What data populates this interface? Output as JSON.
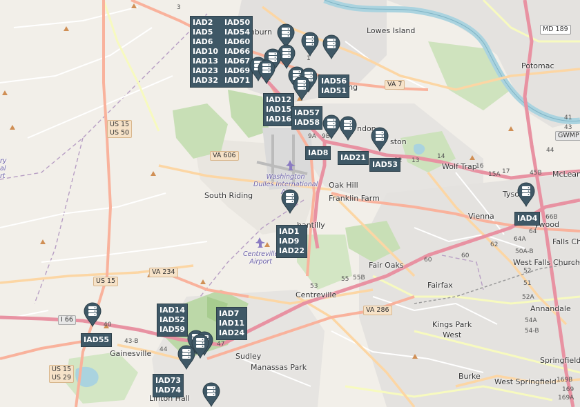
{
  "map": {
    "place_labels": [
      {
        "id": "ashburn",
        "text": "shburn"
      },
      {
        "id": "lowes-island",
        "text": "Lowes Island"
      },
      {
        "id": "potomac",
        "text": "Potomac"
      },
      {
        "id": "sterling",
        "text": "ling"
      },
      {
        "id": "herndon",
        "text": "ndon"
      },
      {
        "id": "reston",
        "text": "ston"
      },
      {
        "id": "wolf-trap",
        "text": "Wolf Trap"
      },
      {
        "id": "mclean",
        "text": "McLean"
      },
      {
        "id": "tysons",
        "text": "Tyso"
      },
      {
        "id": "tysons2",
        "text": "ywood"
      },
      {
        "id": "vienna",
        "text": "Vienna"
      },
      {
        "id": "falls-church",
        "text": "Falls Ch"
      },
      {
        "id": "west-falls-church",
        "text": "West Falls Church"
      },
      {
        "id": "oak-hill",
        "text": "Oak Hill"
      },
      {
        "id": "franklin-farm",
        "text": "Franklin Farm"
      },
      {
        "id": "south-riding",
        "text": "South Riding"
      },
      {
        "id": "chantilly",
        "text": "hantilly"
      },
      {
        "id": "fair-oaks",
        "text": "Fair Oaks"
      },
      {
        "id": "fairfax",
        "text": "Fairfax"
      },
      {
        "id": "centreville",
        "text": "Centreville"
      },
      {
        "id": "annandale",
        "text": "Annandale"
      },
      {
        "id": "kings-park-west",
        "text": "Kings Park\nWest"
      },
      {
        "id": "springfield",
        "text": "Springfield"
      },
      {
        "id": "burke",
        "text": "Burke"
      },
      {
        "id": "west-springfield",
        "text": "West Springfield"
      },
      {
        "id": "sudley",
        "text": "Sudley"
      },
      {
        "id": "manassas-park",
        "text": "Manassas Park"
      },
      {
        "id": "gainesville",
        "text": "Gainesville"
      },
      {
        "id": "linton-hall",
        "text": "Linton Hall"
      },
      {
        "id": "left-edge-1",
        "text": "ry"
      },
      {
        "id": "left-edge-2",
        "text": "al"
      },
      {
        "id": "left-edge-3",
        "text": "rt"
      }
    ],
    "airports": [
      {
        "id": "dulles",
        "text": "Washington\nDulles International\nAir"
      },
      {
        "id": "centreville-airport",
        "text": "Centreville\nAirport"
      }
    ],
    "shields": [
      {
        "id": "md189",
        "text": "MD 189"
      },
      {
        "id": "us15-us50",
        "text": "US 15\nUS 50"
      },
      {
        "id": "va606",
        "text": "VA 606"
      },
      {
        "id": "va7",
        "text": "VA 7"
      },
      {
        "id": "va234",
        "text": "VA 234"
      },
      {
        "id": "us15",
        "text": "US 15"
      },
      {
        "id": "va286",
        "text": "VA 286"
      },
      {
        "id": "i66",
        "text": "I 66"
      },
      {
        "id": "us15-us29",
        "text": "US 15\nUS 29"
      },
      {
        "id": "gwmp",
        "text": "GWMP"
      }
    ],
    "road_numbers": [
      {
        "id": "n-12",
        "text": "12"
      },
      {
        "id": "n-13",
        "text": "13"
      },
      {
        "id": "n-14",
        "text": "14"
      },
      {
        "id": "n-15a",
        "text": "15A"
      },
      {
        "id": "n-16",
        "text": "16"
      },
      {
        "id": "n-17",
        "text": "17"
      },
      {
        "id": "n-45b",
        "text": "45B"
      },
      {
        "id": "n-44",
        "text": "44"
      },
      {
        "id": "n-43",
        "text": "43"
      },
      {
        "id": "n-41",
        "text": "41"
      },
      {
        "id": "n-66b",
        "text": "66B"
      },
      {
        "id": "n-64",
        "text": "64"
      },
      {
        "id": "n-64a",
        "text": "64A"
      },
      {
        "id": "n-62",
        "text": "62"
      },
      {
        "id": "n-60a",
        "text": "60"
      },
      {
        "id": "n-60b",
        "text": "60"
      },
      {
        "id": "n-55",
        "text": "55"
      },
      {
        "id": "n-55b",
        "text": "55B"
      },
      {
        "id": "n-53",
        "text": "53"
      },
      {
        "id": "n-52",
        "text": "52"
      },
      {
        "id": "n-52a",
        "text": "52A"
      },
      {
        "id": "n-54a",
        "text": "54A"
      },
      {
        "id": "n-54b",
        "text": "54-B"
      },
      {
        "id": "n-51",
        "text": "51"
      },
      {
        "id": "n-50a",
        "text": "50A-B"
      },
      {
        "id": "n-169b",
        "text": "169B"
      },
      {
        "id": "n-169",
        "text": "169"
      },
      {
        "id": "n-169a",
        "text": "169A"
      },
      {
        "id": "n-47",
        "text": "47"
      },
      {
        "id": "n-44b",
        "text": "44"
      },
      {
        "id": "n-43b",
        "text": "43-B"
      },
      {
        "id": "n-40",
        "text": "40"
      },
      {
        "id": "n-9a",
        "text": "9A"
      },
      {
        "id": "n-9b",
        "text": "9B"
      },
      {
        "id": "n-3",
        "text": "3"
      },
      {
        "id": "n-1",
        "text": "1"
      }
    ],
    "datacenter_labels": [
      {
        "id": "grp-ashburn",
        "cols": true,
        "items": [
          "IAD2",
          "IAD50",
          "IAD5",
          "IAD54",
          "IAD6",
          "IAD60",
          "IAD10",
          "IAD66",
          "IAD13",
          "IAD67",
          "IAD23",
          "IAD69",
          "IAD32",
          "IAD71"
        ]
      },
      {
        "id": "grp-iad56",
        "items": [
          "IAD56",
          "IAD51"
        ]
      },
      {
        "id": "grp-iad12",
        "items": [
          "IAD12",
          "IAD15",
          "IAD16"
        ]
      },
      {
        "id": "grp-iad57",
        "items": [
          "IAD57",
          "IAD58"
        ]
      },
      {
        "id": "grp-iad8",
        "items": [
          "IAD8"
        ]
      },
      {
        "id": "grp-iad21",
        "items": [
          "IAD21"
        ]
      },
      {
        "id": "grp-iad53",
        "items": [
          "IAD53"
        ]
      },
      {
        "id": "grp-iad4",
        "items": [
          "IAD4"
        ]
      },
      {
        "id": "grp-iad1",
        "items": [
          "IAD1",
          "IAD9",
          "IAD22"
        ]
      },
      {
        "id": "grp-iad55",
        "items": [
          "IAD55"
        ]
      },
      {
        "id": "grp-iad14",
        "items": [
          "IAD14",
          "IAD52",
          "IAD59"
        ]
      },
      {
        "id": "grp-iad7",
        "items": [
          "IAD7",
          "IAD11",
          "IAD24"
        ]
      },
      {
        "id": "grp-iad73",
        "items": [
          "IAD73",
          "IAD74"
        ]
      }
    ],
    "marker_icon": "server-icon",
    "colors": {
      "land": "#f2efe9",
      "water": "#aad3df",
      "forest": "#add19e",
      "urban": "#e0dfdf",
      "motorway": "#e892a2",
      "trunk": "#f9b29c",
      "primary": "#fcd6a4",
      "marker": "#3f5866",
      "label_bg": "#3f5866"
    }
  }
}
